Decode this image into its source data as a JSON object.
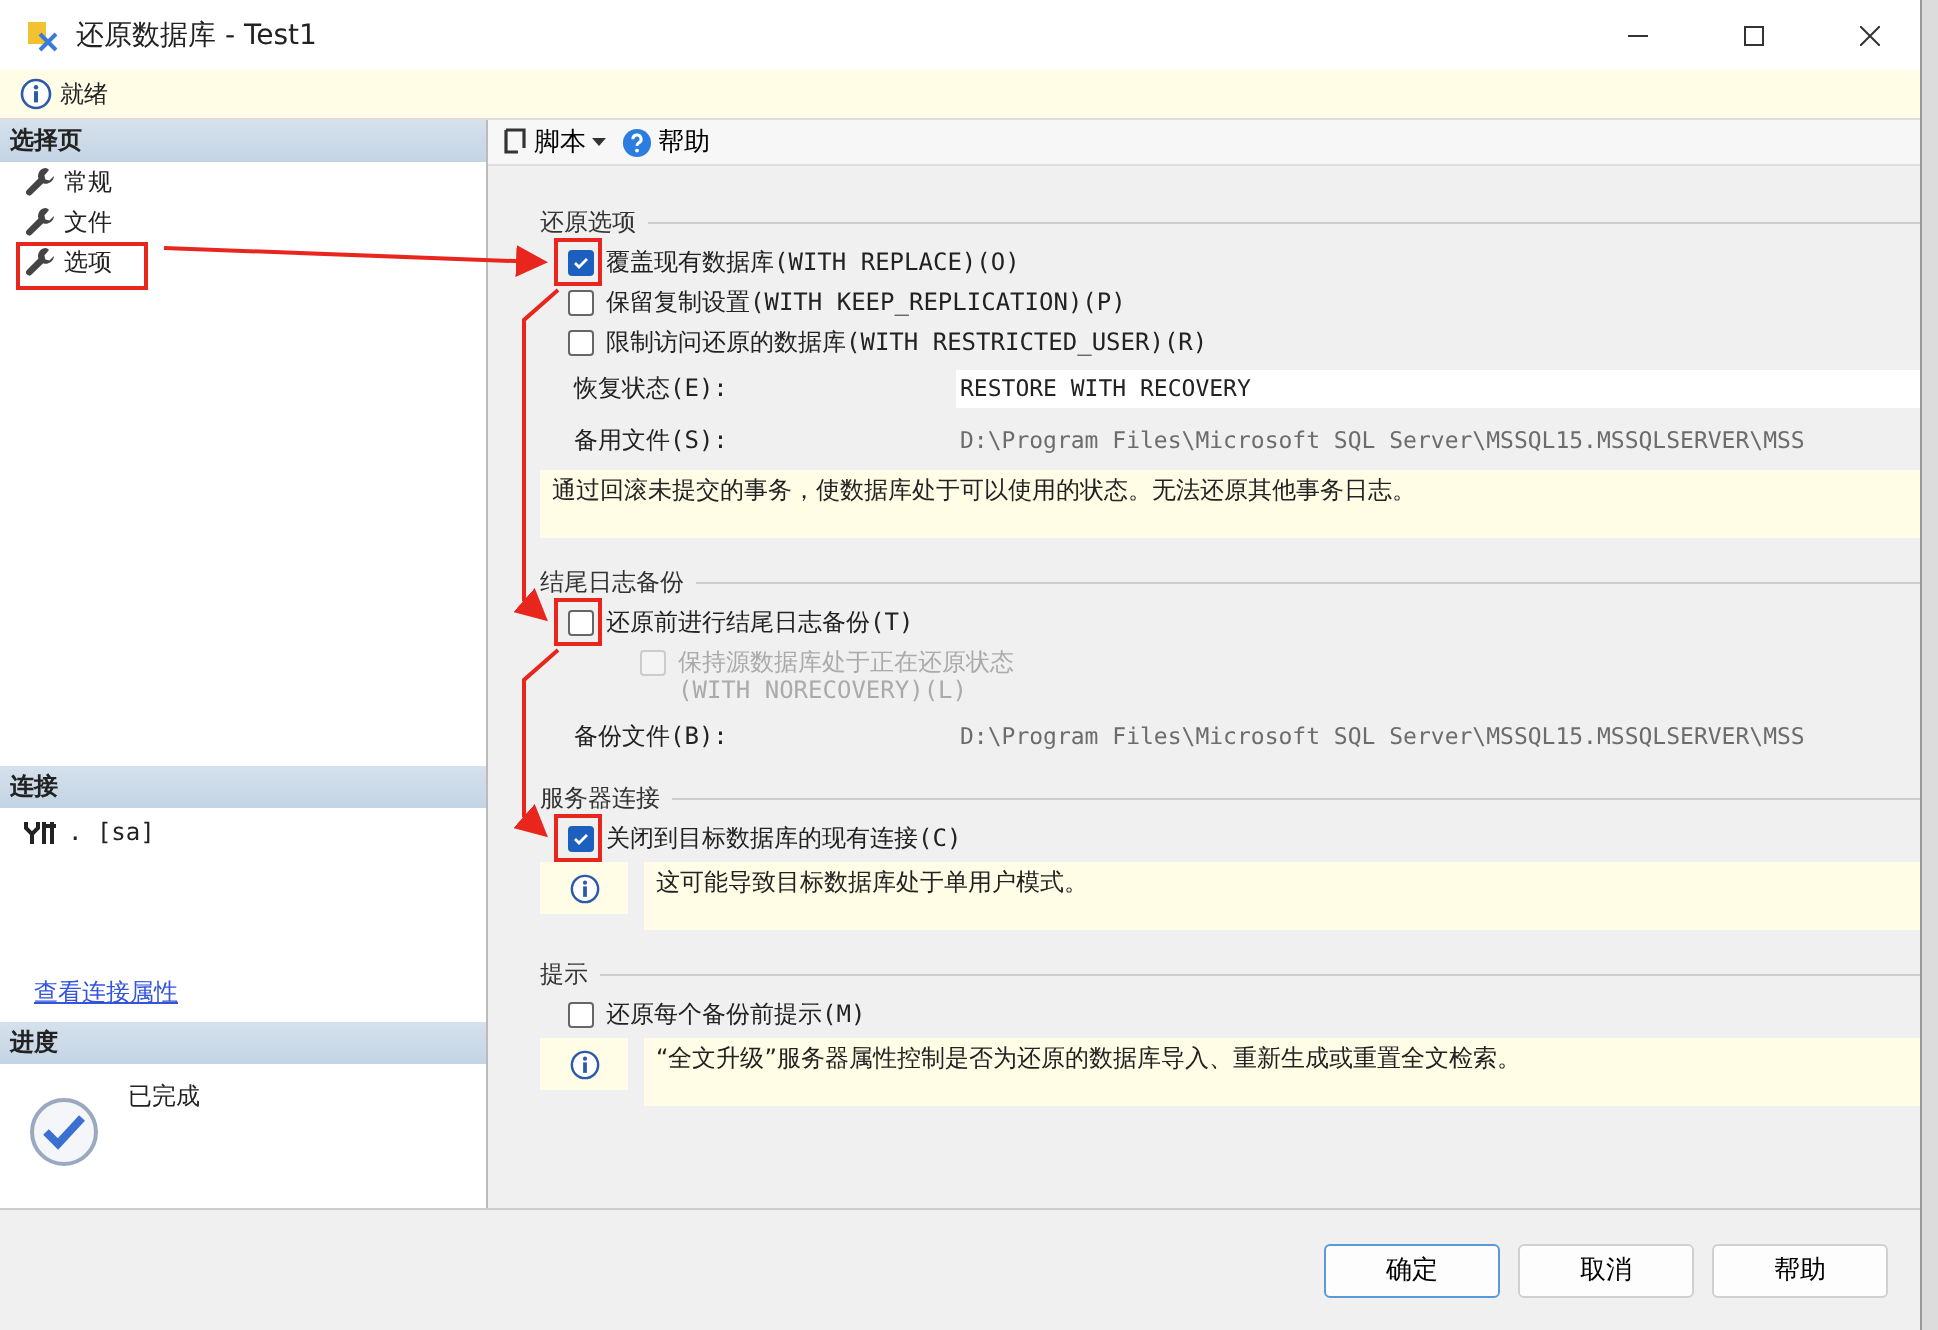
{
  "window": {
    "title": "还原数据库 - Test1"
  },
  "status": {
    "text": "就绪"
  },
  "sidebar": {
    "pages_header": "选择页",
    "pages": [
      {
        "label": "常规",
        "highlighted": false
      },
      {
        "label": "文件",
        "highlighted": false
      },
      {
        "label": "选项",
        "highlighted": true
      }
    ],
    "connection_header": "连接",
    "connection": ". [sa]",
    "connection_link": "查看连接属性",
    "progress_header": "进度",
    "progress": "已完成"
  },
  "toolbar": {
    "script": "脚本",
    "help": "帮助"
  },
  "sections": [
    {
      "title": "还原选项",
      "items": [
        {
          "kind": "checkbox",
          "label": "覆盖现有数据库(WITH REPLACE)(O)",
          "checked": true,
          "disabled": false,
          "highlighted": true
        },
        {
          "kind": "checkbox",
          "label": "保留复制设置(WITH KEEP_REPLICATION)(P)",
          "checked": false,
          "disabled": false,
          "highlighted": false
        },
        {
          "kind": "checkbox",
          "label": "限制访问还原的数据库(WITH RESTRICTED_USER)(R)",
          "checked": false,
          "disabled": false,
          "highlighted": false
        },
        {
          "kind": "field",
          "label": "恢复状态(E):",
          "value": "RESTORE WITH RECOVERY",
          "editable": true
        },
        {
          "kind": "field",
          "label": "备用文件(S):",
          "value": "D:\\Program Files\\Microsoft SQL Server\\MSSQL15.MSSQLSERVER\\MSS",
          "editable": false
        },
        {
          "kind": "note",
          "text": "通过回滚未提交的事务，使数据库处于可以使用的状态。无法还原其他事务日志。",
          "icon": false
        }
      ]
    },
    {
      "title": "结尾日志备份",
      "items": [
        {
          "kind": "checkbox",
          "label": "还原前进行结尾日志备份(T)",
          "checked": false,
          "disabled": false,
          "highlighted": true
        },
        {
          "kind": "checkbox",
          "label": "保持源数据库处于正在还原状态\n(WITH NORECOVERY)(L)",
          "checked": false,
          "disabled": true,
          "highlighted": false
        },
        {
          "kind": "field",
          "label": "备份文件(B):",
          "value": "D:\\Program Files\\Microsoft SQL Server\\MSSQL15.MSSQLSERVER\\MSS",
          "editable": false
        }
      ]
    },
    {
      "title": "服务器连接",
      "items": [
        {
          "kind": "checkbox",
          "label": "关闭到目标数据库的现有连接(C)",
          "checked": true,
          "disabled": false,
          "highlighted": true
        },
        {
          "kind": "note",
          "text": "这可能导致目标数据库处于单用户模式。",
          "icon": true
        }
      ]
    },
    {
      "title": "提示",
      "items": [
        {
          "kind": "checkbox",
          "label": "还原每个备份前提示(M)",
          "checked": false,
          "disabled": false,
          "highlighted": false
        },
        {
          "kind": "note",
          "text": "“全文升级”服务器属性控制是否为还原的数据库导入、重新生成或重置全文检索。",
          "icon": true
        }
      ]
    }
  ],
  "buttons": [
    {
      "label": "确定",
      "selected": true
    },
    {
      "label": "取消",
      "selected": false
    },
    {
      "label": "帮助",
      "selected": false
    }
  ]
}
